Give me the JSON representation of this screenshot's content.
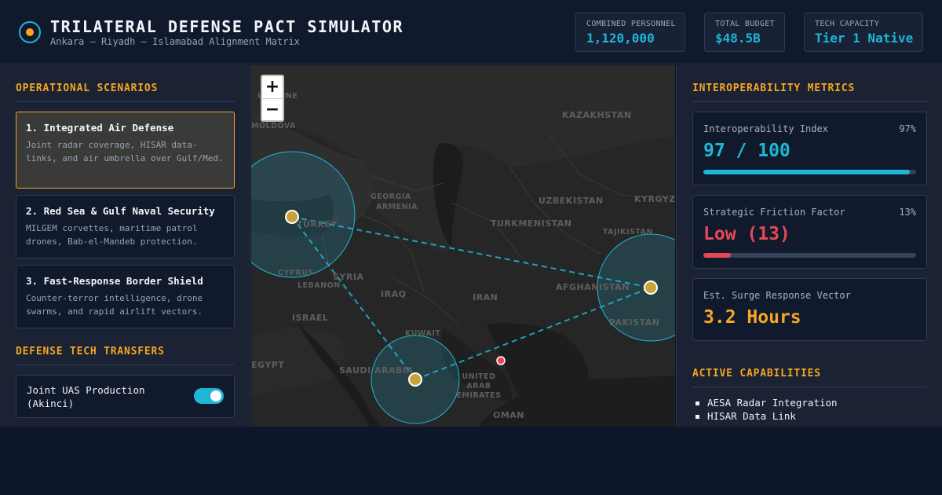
{
  "header": {
    "title": "TRILATERAL DEFENSE PACT SIMULATOR",
    "subtitle": "Ankara – Riyadh – Islamabad Alignment Matrix",
    "stats": [
      {
        "label": "COMBINED PERSONNEL",
        "value": "1,120,000"
      },
      {
        "label": "TOTAL BUDGET",
        "value": "$48.5B"
      },
      {
        "label": "TECH CAPACITY",
        "value": "Tier 1 Native"
      }
    ]
  },
  "left": {
    "scenarios_title": "OPERATIONAL SCENARIOS",
    "scenarios": [
      {
        "title": "1. Integrated Air Defense",
        "desc": "Joint radar coverage, HISAR data-links, and air umbrella over Gulf/Med.",
        "active": true
      },
      {
        "title": "2. Red Sea & Gulf Naval Security",
        "desc": "MILGEM corvettes, maritime patrol drones, Bab-el-Mandeb protection.",
        "active": false
      },
      {
        "title": "3. Fast-Response Border Shield",
        "desc": "Counter-terror intelligence, drone swarms, and rapid airlift vectors.",
        "active": false
      }
    ],
    "transfers_title": "DEFENSE TECH TRANSFERS",
    "transfers": [
      {
        "label": "Joint UAS Production (Akinci)",
        "enabled": true
      }
    ]
  },
  "map": {
    "zoom_in": "+",
    "zoom_out": "−",
    "labels": [
      {
        "text": "UKRAINE"
      },
      {
        "text": "MOLDOVA"
      },
      {
        "text": "KAZAKHSTAN"
      },
      {
        "text": "GEORGIA"
      },
      {
        "text": "ARMENIA"
      },
      {
        "text": "UZBEKISTAN"
      },
      {
        "text": "KYRGYZSTAN"
      },
      {
        "text": "TURKEY"
      },
      {
        "text": "TURKMENISTAN"
      },
      {
        "text": "TAJIKISTAN"
      },
      {
        "text": "CYPRUS"
      },
      {
        "text": "SYRIA"
      },
      {
        "text": "LEBANON"
      },
      {
        "text": "IRAQ"
      },
      {
        "text": "IRAN"
      },
      {
        "text": "AFGHANISTAN"
      },
      {
        "text": "ISRAEL"
      },
      {
        "text": "PAKISTAN"
      },
      {
        "text": "KUWAIT"
      },
      {
        "text": "EGYPT"
      },
      {
        "text": "SAUDI ARABIA"
      },
      {
        "text": "UNITED ARAB EMIRATES"
      },
      {
        "text": "OMAN"
      }
    ]
  },
  "right": {
    "metrics_title": "INTEROPERABILITY METRICS",
    "metrics": [
      {
        "label": "Interoperability Index",
        "pct": "97%",
        "value": "97 / 100",
        "level": 0.97,
        "color": "#1fb6d6"
      },
      {
        "label": "Strategic Friction Factor",
        "pct": "13%",
        "value": "Low (13)",
        "level": 0.13,
        "color": "#e84855"
      },
      {
        "label": "Est. Surge Response Vector",
        "value": "3.2 Hours",
        "color": "#f5a623"
      }
    ],
    "capabilities_title": "ACTIVE CAPABILITIES",
    "capabilities": [
      "AESA Radar Integration",
      "HISAR Data Link"
    ]
  },
  "colors": {
    "accent": "#1fb6d6",
    "warning": "#f5a623",
    "danger": "#e84855",
    "background": "#0e1629"
  },
  "icons": {
    "logo": "target-icon",
    "node": "base-marker-icon",
    "incident": "alert-dot-icon"
  }
}
